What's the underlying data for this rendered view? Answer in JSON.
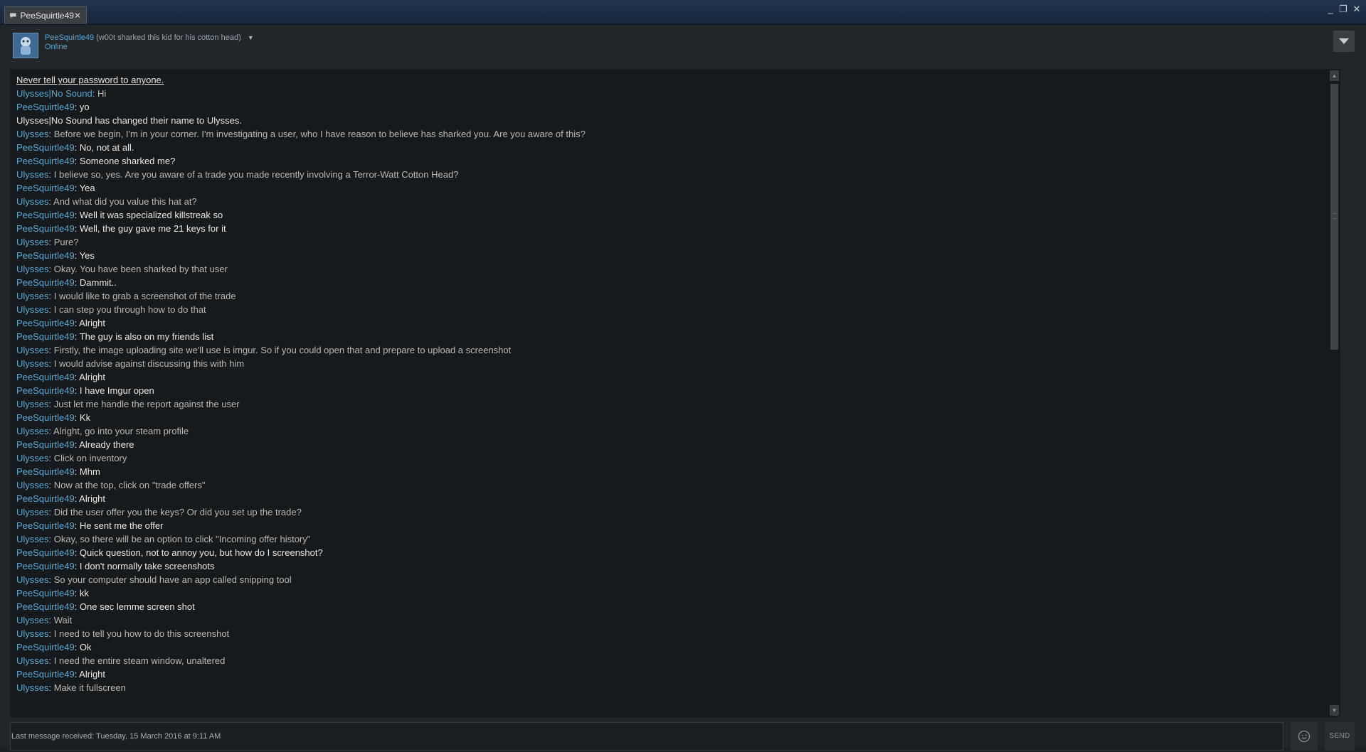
{
  "window": {
    "tab_title": "PeeSquirtle49",
    "tab_close": "✕",
    "minimize": "_",
    "maximize": "❐",
    "close": "✕"
  },
  "header": {
    "friend_name": "PeeSquirtle49",
    "friend_nickname": "(w00t sharked this kid for his cotton head)",
    "dropdown": "▼",
    "status": "Online"
  },
  "chat": {
    "warning": "Never tell your password to anyone.",
    "messages": [
      {
        "sender": "Ulysses|No Sound",
        "text": ": Hi",
        "who": "u"
      },
      {
        "sender": "PeeSquirtle49",
        "text": ": yo",
        "who": "p"
      },
      {
        "system": "Ulysses|No Sound has changed their name to Ulysses."
      },
      {
        "sender": "Ulysses",
        "text": ": Before we begin, I'm in your corner. I'm investigating a user, who I have reason to believe has sharked you. Are you aware of this?",
        "who": "u"
      },
      {
        "sender": "PeeSquirtle49",
        "text": ": No, not at all.",
        "who": "p"
      },
      {
        "sender": "PeeSquirtle49",
        "text": ": Someone sharked me?",
        "who": "p"
      },
      {
        "sender": "Ulysses",
        "text": ": I believe so, yes. Are you aware of a trade you made recently involving a Terror-Watt Cotton Head?",
        "who": "u"
      },
      {
        "sender": "PeeSquirtle49",
        "text": ": Yea",
        "who": "p"
      },
      {
        "sender": "Ulysses",
        "text": ": And what did you value this hat at?",
        "who": "u"
      },
      {
        "sender": "PeeSquirtle49",
        "text": ": Well it was specialized killstreak so",
        "who": "p"
      },
      {
        "sender": "PeeSquirtle49",
        "text": ": Well, the guy gave me 21 keys for it",
        "who": "p"
      },
      {
        "sender": "Ulysses",
        "text": ": Pure?",
        "who": "u"
      },
      {
        "sender": "PeeSquirtle49",
        "text": ": Yes",
        "who": "p"
      },
      {
        "sender": "Ulysses",
        "text": ": Okay. You have been sharked by that user",
        "who": "u"
      },
      {
        "sender": "PeeSquirtle49",
        "text": ": Dammit..",
        "who": "p"
      },
      {
        "sender": "Ulysses",
        "text": ": I would like to grab a screenshot of the trade",
        "who": "u"
      },
      {
        "sender": "Ulysses",
        "text": ": I can step you through how to do that",
        "who": "u"
      },
      {
        "sender": "PeeSquirtle49",
        "text": ": Alright",
        "who": "p"
      },
      {
        "sender": "PeeSquirtle49",
        "text": ": The guy is also on my friends list",
        "who": "p"
      },
      {
        "sender": "Ulysses",
        "text": ": Firstly, the image uploading site we'll use is imgur. So if you could open that and prepare to upload a screenshot",
        "who": "u"
      },
      {
        "sender": "Ulysses",
        "text": ": I would advise against discussing this with him",
        "who": "u"
      },
      {
        "sender": "PeeSquirtle49",
        "text": ": Alright",
        "who": "p"
      },
      {
        "sender": "PeeSquirtle49",
        "text": ": I have Imgur open",
        "who": "p"
      },
      {
        "sender": "Ulysses",
        "text": ": Just let me handle the report against the user",
        "who": "u"
      },
      {
        "sender": "PeeSquirtle49",
        "text": ": Kk",
        "who": "p"
      },
      {
        "sender": "Ulysses",
        "text": ": Alright, go into your steam profile",
        "who": "u"
      },
      {
        "sender": "PeeSquirtle49",
        "text": ": Already there",
        "who": "p"
      },
      {
        "sender": "Ulysses",
        "text": ": Click on inventory",
        "who": "u"
      },
      {
        "sender": "PeeSquirtle49",
        "text": ": Mhm",
        "who": "p"
      },
      {
        "sender": "Ulysses",
        "text": ": Now at the top, click on \"trade offers\"",
        "who": "u"
      },
      {
        "sender": "PeeSquirtle49",
        "text": ": Alright",
        "who": "p"
      },
      {
        "sender": "Ulysses",
        "text": ": Did the user offer you the keys? Or did you set up the trade?",
        "who": "u"
      },
      {
        "sender": "PeeSquirtle49",
        "text": ": He sent me the offer",
        "who": "p"
      },
      {
        "sender": "Ulysses",
        "text": ": Okay, so there will be an option to click \"Incoming offer history\"",
        "who": "u"
      },
      {
        "sender": "PeeSquirtle49",
        "text": ": Quick question, not to annoy you, but how do I screenshot?",
        "who": "p"
      },
      {
        "sender": "PeeSquirtle49",
        "text": ": I don't normally take screenshots",
        "who": "p"
      },
      {
        "sender": "Ulysses",
        "text": ": So your computer should have an app called snipping tool",
        "who": "u"
      },
      {
        "sender": "PeeSquirtle49",
        "text": ": kk",
        "who": "p"
      },
      {
        "sender": "PeeSquirtle49",
        "text": ": One sec lemme screen shot",
        "who": "p"
      },
      {
        "sender": "Ulysses",
        "text": ": Wait",
        "who": "u"
      },
      {
        "sender": "Ulysses",
        "text": ": I need to tell you how to do this screenshot",
        "who": "u"
      },
      {
        "sender": "PeeSquirtle49",
        "text": ": Ok",
        "who": "p"
      },
      {
        "sender": "Ulysses",
        "text": ": I need the entire steam window, unaltered",
        "who": "u"
      },
      {
        "sender": "PeeSquirtle49",
        "text": ": Alright",
        "who": "p"
      },
      {
        "sender": "Ulysses",
        "text": ": Make it fullscreen",
        "who": "u"
      }
    ]
  },
  "input": {
    "placeholder": "",
    "send_label": "SEND",
    "emoji_icon": "emoticon-icon"
  },
  "footer": {
    "last_message": "Last message received: Tuesday, 15 March 2016 at 9:11 AM"
  },
  "colors": {
    "name_blue": "#5aa9d6",
    "background": "#171a1c"
  }
}
